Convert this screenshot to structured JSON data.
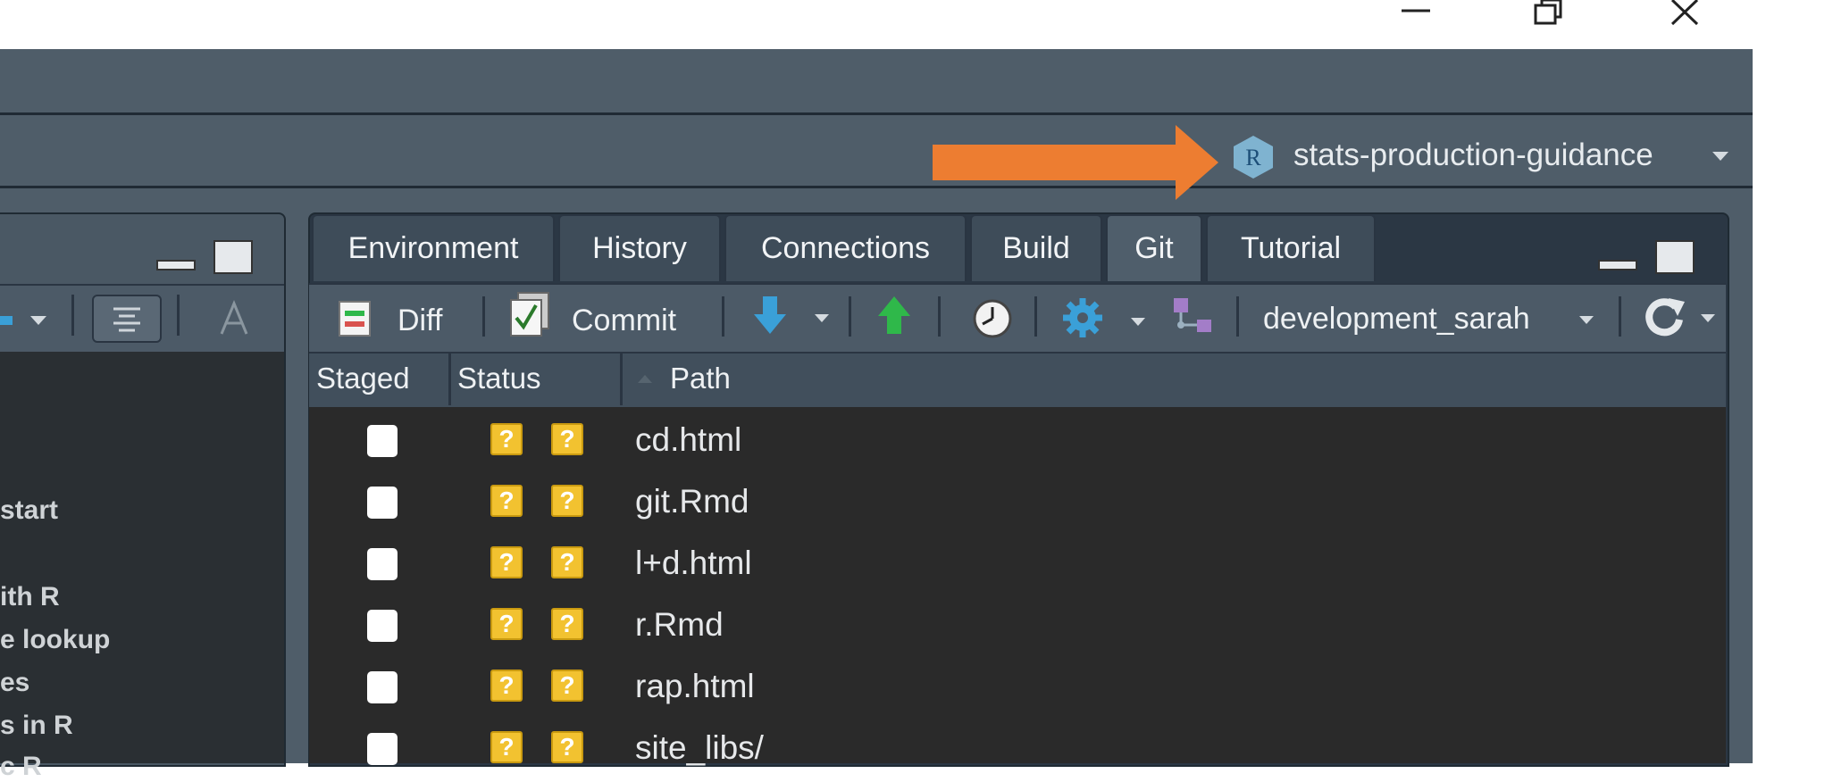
{
  "window": {
    "controls": [
      "minimize-icon",
      "restore-icon",
      "close-icon"
    ]
  },
  "project": {
    "name": "stats-production-guidance",
    "icon": "r-project-icon",
    "annotation": "orange-arrow"
  },
  "left_pane": {
    "visible_lines": [
      "start",
      "ith R",
      "e lookup",
      "es",
      "s in R",
      "c R"
    ]
  },
  "right_pane": {
    "tabs": [
      {
        "label": "Environment",
        "active": false
      },
      {
        "label": "History",
        "active": false
      },
      {
        "label": "Connections",
        "active": false
      },
      {
        "label": "Build",
        "active": false
      },
      {
        "label": "Git",
        "active": true
      },
      {
        "label": "Tutorial",
        "active": false
      }
    ],
    "toolbar": {
      "diff_label": "Diff",
      "commit_label": "Commit",
      "branch": "development_sarah"
    },
    "columns": {
      "staged": "Staged",
      "status": "Status",
      "path": "Path"
    },
    "files": [
      {
        "staged": false,
        "status": [
          "?",
          "?"
        ],
        "path": "cd.html"
      },
      {
        "staged": false,
        "status": [
          "?",
          "?"
        ],
        "path": "git.Rmd"
      },
      {
        "staged": false,
        "status": [
          "?",
          "?"
        ],
        "path": "l+d.html"
      },
      {
        "staged": false,
        "status": [
          "?",
          "?"
        ],
        "path": "r.Rmd"
      },
      {
        "staged": false,
        "status": [
          "?",
          "?"
        ],
        "path": "rap.html"
      },
      {
        "staged": false,
        "status": [
          "?",
          "?"
        ],
        "path": "site_libs/"
      }
    ]
  },
  "colors": {
    "annotation_arrow": "#ed7d31",
    "status_badge": "#f2c230",
    "pull_arrow": "#3aa0d8",
    "push_arrow": "#2fb84a"
  }
}
